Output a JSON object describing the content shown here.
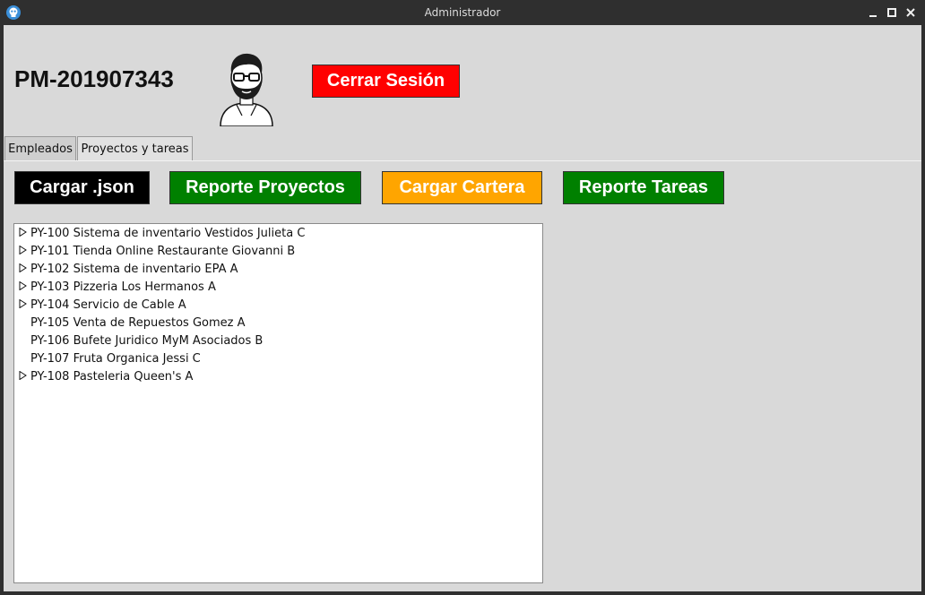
{
  "window": {
    "title": "Administrador"
  },
  "header": {
    "user_id": "PM-201907343",
    "logout_label": "Cerrar Sesión"
  },
  "tabs": [
    {
      "label": "Empleados",
      "active": false
    },
    {
      "label": "Proyectos y tareas",
      "active": true
    }
  ],
  "toolbar": {
    "load_json_label": "Cargar .json",
    "projects_report_label": "Reporte Proyectos",
    "load_portfolio_label": "Cargar Cartera",
    "tasks_report_label": "Reporte Tareas"
  },
  "colors": {
    "logout": "#ff0000",
    "load_json": "#000000",
    "report": "#008000",
    "portfolio": "#ffa500"
  },
  "projects": [
    {
      "label": "PY-100 Sistema de inventario Vestidos Julieta C",
      "expandable": true
    },
    {
      "label": "PY-101 Tienda Online Restaurante Giovanni B",
      "expandable": true
    },
    {
      "label": "PY-102 Sistema de inventario EPA A",
      "expandable": true
    },
    {
      "label": "PY-103 Pizzeria Los Hermanos A",
      "expandable": true
    },
    {
      "label": "PY-104 Servicio de Cable A",
      "expandable": true
    },
    {
      "label": "PY-105 Venta de Repuestos Gomez A",
      "expandable": false
    },
    {
      "label": "PY-106 Bufete Juridico MyM Asociados B",
      "expandable": false
    },
    {
      "label": "PY-107 Fruta Organica Jessi C",
      "expandable": false
    },
    {
      "label": "PY-108 Pasteleria Queen's A",
      "expandable": true
    }
  ]
}
